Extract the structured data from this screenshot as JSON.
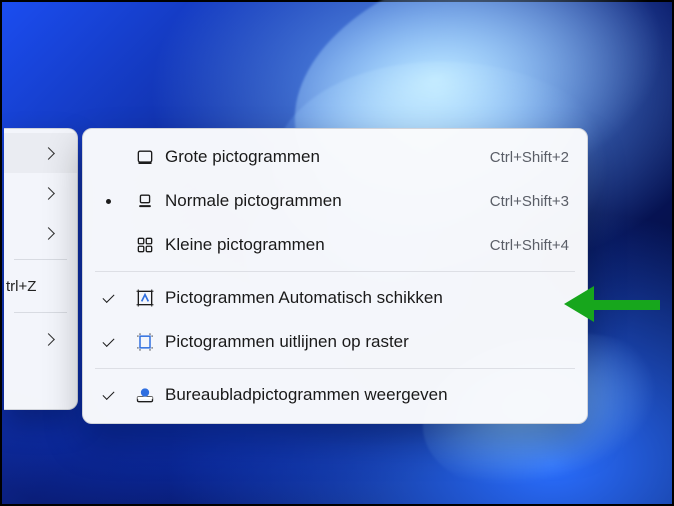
{
  "parent_menu": {
    "items": [
      {
        "shortcut": "trl+Z"
      }
    ]
  },
  "submenu": {
    "groups": [
      {
        "items": [
          {
            "key": "large",
            "label": "Grote pictogrammen",
            "shortcut": "Ctrl+Shift+2",
            "icon": "large-icons-icon",
            "mark": ""
          },
          {
            "key": "medium",
            "label": "Normale pictogrammen",
            "shortcut": "Ctrl+Shift+3",
            "icon": "medium-icons-icon",
            "mark": "radio"
          },
          {
            "key": "small",
            "label": "Kleine pictogrammen",
            "shortcut": "Ctrl+Shift+4",
            "icon": "small-icons-icon",
            "mark": ""
          }
        ]
      },
      {
        "items": [
          {
            "key": "autoarrange",
            "label": "Pictogrammen Automatisch schikken",
            "shortcut": "",
            "icon": "auto-arrange-icon",
            "mark": "check"
          },
          {
            "key": "align",
            "label": "Pictogrammen uitlijnen op raster",
            "shortcut": "",
            "icon": "align-to-grid-icon",
            "mark": "check"
          }
        ]
      },
      {
        "items": [
          {
            "key": "show",
            "label": "Bureaubladpictogrammen weergeven",
            "shortcut": "",
            "icon": "show-desktop-icons-icon",
            "mark": "check"
          }
        ]
      }
    ]
  },
  "annotation": {
    "color": "#17a61c",
    "target": "autoarrange"
  }
}
